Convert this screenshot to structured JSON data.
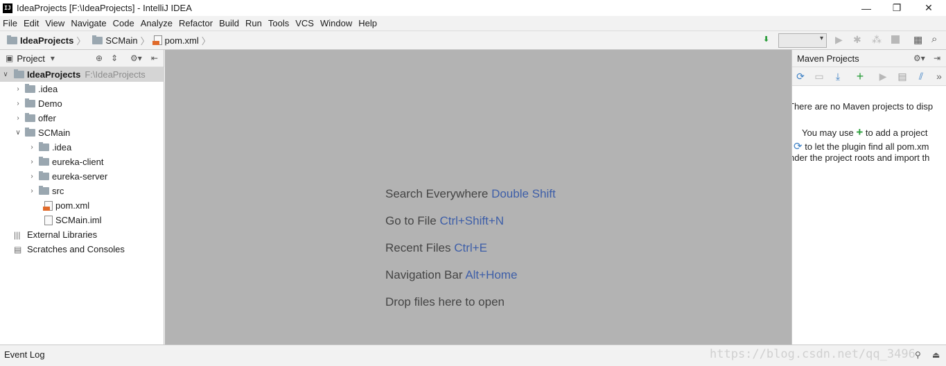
{
  "titlebar": {
    "app_icon": "IJ",
    "title": "IdeaProjects [F:\\IdeaProjects] - IntelliJ IDEA",
    "minimize": "—",
    "restore": "❐",
    "close": "✕"
  },
  "menu": [
    "File",
    "Edit",
    "View",
    "Navigate",
    "Code",
    "Analyze",
    "Refactor",
    "Build",
    "Run",
    "Tools",
    "VCS",
    "Window",
    "Help"
  ],
  "breadcrumb": [
    "IdeaProjects",
    "SCMain",
    "pom.xml"
  ],
  "project_panel": {
    "title": "Project",
    "tree": [
      {
        "label": "IdeaProjects",
        "hint": "F:\\IdeaProjects"
      },
      {
        "label": ".idea"
      },
      {
        "label": "Demo"
      },
      {
        "label": "offer"
      },
      {
        "label": "SCMain"
      },
      {
        "label": ".idea"
      },
      {
        "label": "eureka-client"
      },
      {
        "label": "eureka-server"
      },
      {
        "label": "src"
      },
      {
        "label": "pom.xml"
      },
      {
        "label": "SCMain.iml"
      },
      {
        "label": "External Libraries"
      },
      {
        "label": "Scratches and Consoles"
      }
    ]
  },
  "editor": {
    "hints": [
      {
        "text": "Search Everywhere",
        "key": "Double Shift"
      },
      {
        "text": "Go to File",
        "key": "Ctrl+Shift+N"
      },
      {
        "text": "Recent Files",
        "key": "Ctrl+E"
      },
      {
        "text": "Navigation Bar",
        "key": "Alt+Home"
      },
      {
        "text": "Drop files here to open",
        "key": ""
      }
    ]
  },
  "maven": {
    "title": "Maven Projects",
    "line1": "There are no Maven projects to disp",
    "line2a": "You may use",
    "line2b": "to add a project",
    "line3": "to let the plugin find all pom.xm",
    "line4": "nder the project roots and import th"
  },
  "statusbar": {
    "event_log": "Event Log",
    "watermark": "https://blog.csdn.net/qq_3496"
  },
  "colors": {
    "editor_bg": "#b3b3b3",
    "shortcut": "#3d5ea8",
    "add": "#2a9d3a",
    "selection": "#d5d5d5"
  }
}
